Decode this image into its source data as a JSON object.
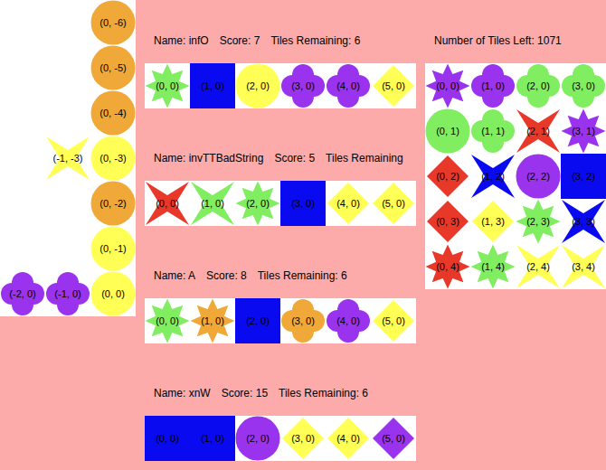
{
  "board": {
    "rows": [
      [
        null,
        null,
        {
          "label": "(0, -6)",
          "kind": "circle",
          "color": "#f0a838"
        }
      ],
      [
        null,
        null,
        {
          "label": "(0, -5)",
          "kind": "circle",
          "color": "#f0a838"
        }
      ],
      [
        null,
        null,
        {
          "label": "(0, -4)",
          "kind": "circle",
          "color": "#f0a838"
        }
      ],
      [
        null,
        {
          "label": "(-1, -3)",
          "kind": "star4",
          "color": "#ffff55"
        },
        {
          "label": "(0, -3)",
          "kind": "circle",
          "color": "#ffff55"
        }
      ],
      [
        null,
        null,
        {
          "label": "(0, -2)",
          "kind": "circle",
          "color": "#f0a838"
        }
      ],
      [
        null,
        null,
        {
          "label": "(0, -1)",
          "kind": "circle",
          "color": "#ffff55"
        }
      ],
      [
        {
          "label": "(-2, 0)",
          "kind": "clover",
          "color": "#9933ee"
        },
        {
          "label": "(-1, 0)",
          "kind": "clover",
          "color": "#9933ee"
        },
        {
          "label": "(0, 0)",
          "kind": "circle",
          "color": "#ffff55"
        }
      ]
    ]
  },
  "players": [
    {
      "name": "Name: infO",
      "score": "Score: 7",
      "tiles_remaining": "Tiles Remaining: 6",
      "hand": [
        {
          "label": "(0, 0)",
          "kind": "star8",
          "color": "#80ee60"
        },
        {
          "label": "(1, 0)",
          "kind": "square",
          "color": "#0a0af0"
        },
        {
          "label": "(2, 0)",
          "kind": "circle",
          "color": "#ffff55"
        },
        {
          "label": "(3, 0)",
          "kind": "clover",
          "color": "#9933ee"
        },
        {
          "label": "(4, 0)",
          "kind": "clover",
          "color": "#9933ee"
        },
        {
          "label": "(5, 0)",
          "kind": "diamond",
          "color": "#ffff55"
        }
      ]
    },
    {
      "name": "Name: invTTBadString",
      "score": "Score: 5",
      "tiles_remaining": "Tiles Remaining",
      "hand": [
        {
          "label": "(0, 0)",
          "kind": "star4",
          "color": "#e8382a"
        },
        {
          "label": "(1, 0)",
          "kind": "star4",
          "color": "#80ee60"
        },
        {
          "label": "(2, 0)",
          "kind": "star8",
          "color": "#80ee60"
        },
        {
          "label": "(3, 0)",
          "kind": "square",
          "color": "#0a0af0"
        },
        {
          "label": "(4, 0)",
          "kind": "diamond",
          "color": "#ffff55"
        },
        {
          "label": "(5, 0)",
          "kind": "diamond",
          "color": "#ffff55"
        }
      ]
    },
    {
      "name": "Name: A",
      "score": "Score: 8",
      "tiles_remaining": "Tiles Remaining: 6",
      "hand": [
        {
          "label": "(0, 0)",
          "kind": "star8",
          "color": "#80ee60"
        },
        {
          "label": "(1, 0)",
          "kind": "star8",
          "color": "#f0a838"
        },
        {
          "label": "(2, 0)",
          "kind": "square",
          "color": "#0a0af0"
        },
        {
          "label": "(3, 0)",
          "kind": "clover",
          "color": "#f0a838"
        },
        {
          "label": "(4, 0)",
          "kind": "clover",
          "color": "#9933ee"
        },
        {
          "label": "(5, 0)",
          "kind": "diamond",
          "color": "#ffff55"
        }
      ]
    },
    {
      "name": "Name: xnW",
      "score": "Score: 15",
      "tiles_remaining": "Tiles Remaining: 6",
      "hand": [
        {
          "label": "(0, 0)",
          "kind": "square",
          "color": "#0a0af0"
        },
        {
          "label": "(1, 0)",
          "kind": "square",
          "color": "#0a0af0"
        },
        {
          "label": "(2, 0)",
          "kind": "circle",
          "color": "#9933ee"
        },
        {
          "label": "(3, 0)",
          "kind": "diamond",
          "color": "#ffff55"
        },
        {
          "label": "(4, 0)",
          "kind": "diamond",
          "color": "#ffff55"
        },
        {
          "label": "(5, 0)",
          "kind": "diamond",
          "color": "#9933ee"
        }
      ]
    }
  ],
  "pool": {
    "title": "Number of Tiles Left: 1071",
    "rows": [
      [
        {
          "label": "(0, 0)",
          "kind": "star8",
          "color": "#9933ee"
        },
        {
          "label": "(1, 0)",
          "kind": "clover",
          "color": "#9933ee"
        },
        {
          "label": "(2, 0)",
          "kind": "clover",
          "color": "#80ee60"
        },
        {
          "label": "(3, 0)",
          "kind": "clover",
          "color": "#80ee60"
        }
      ],
      [
        {
          "label": "(0, 1)",
          "kind": "circle",
          "color": "#80ee60"
        },
        {
          "label": "(1, 1)",
          "kind": "clover",
          "color": "#80ee60"
        },
        {
          "label": "(2, 1)",
          "kind": "star4",
          "color": "#e8382a"
        },
        {
          "label": "(3, 1)",
          "kind": "star8",
          "color": "#9933ee"
        }
      ],
      [
        {
          "label": "(0, 2)",
          "kind": "diamond",
          "color": "#e8382a"
        },
        {
          "label": "(1, 2)",
          "kind": "star4",
          "color": "#0a0af0"
        },
        {
          "label": "(2, 2)",
          "kind": "circle",
          "color": "#9933ee"
        },
        {
          "label": "(3, 2)",
          "kind": "square",
          "color": "#0a0af0"
        }
      ],
      [
        {
          "label": "(0, 3)",
          "kind": "diamond",
          "color": "#e8382a"
        },
        {
          "label": "(1, 3)",
          "kind": "diamond",
          "color": "#ffff55"
        },
        {
          "label": "(2, 3)",
          "kind": "star8",
          "color": "#80ee60"
        },
        {
          "label": "(3, 3)",
          "kind": "star4",
          "color": "#0a0af0"
        }
      ],
      [
        {
          "label": "(0, 4)",
          "kind": "star8",
          "color": "#e8382a"
        },
        {
          "label": "(1, 4)",
          "kind": "star8",
          "color": "#80ee60"
        },
        {
          "label": "(2, 4)",
          "kind": "star4",
          "color": "#ffff55"
        },
        {
          "label": "(3, 4)",
          "kind": "star4",
          "color": "#ffff55"
        }
      ]
    ]
  }
}
